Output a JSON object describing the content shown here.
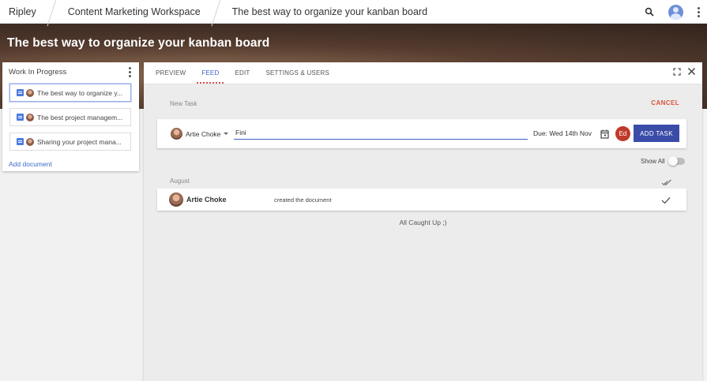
{
  "breadcrumb": {
    "app": "Ripley",
    "workspace": "Content Marketing Workspace",
    "document": "The best way to organize your kanban board"
  },
  "topbar": {
    "icons": [
      "search-icon",
      "account-avatar",
      "more-vert-icon"
    ]
  },
  "hero": {
    "title": "The best way to organize your kanban board"
  },
  "left_panel": {
    "title": "Work In Progress",
    "documents": [
      {
        "label": "The best way to organize y..."
      },
      {
        "label": "The best project managem..."
      },
      {
        "label": "Sharing your project mana..."
      }
    ],
    "add_document": "Add document"
  },
  "tabs": [
    {
      "label": "PREVIEW"
    },
    {
      "label": "FEED"
    },
    {
      "label": "EDIT"
    },
    {
      "label": "SETTINGS & USERS"
    }
  ],
  "active_tab": "FEED",
  "new_task": {
    "label": "New Task",
    "cancel": "CANCEL",
    "assignee": "Artie Choke",
    "input_value": "Fini",
    "due": "Due: Wed 14th Nov",
    "assignee_badge": "Ed",
    "add_task": "ADD TASK"
  },
  "feed": {
    "show_all": "Show All",
    "month": "August",
    "items": [
      {
        "user": "Artie Choke",
        "action": "created the document"
      }
    ],
    "caught_up": "All Caught Up ;)"
  },
  "colors": {
    "accent": "#3b4ba8",
    "cancel": "#d9533a",
    "badge": "#c0392b",
    "link": "#3d6dc7"
  }
}
